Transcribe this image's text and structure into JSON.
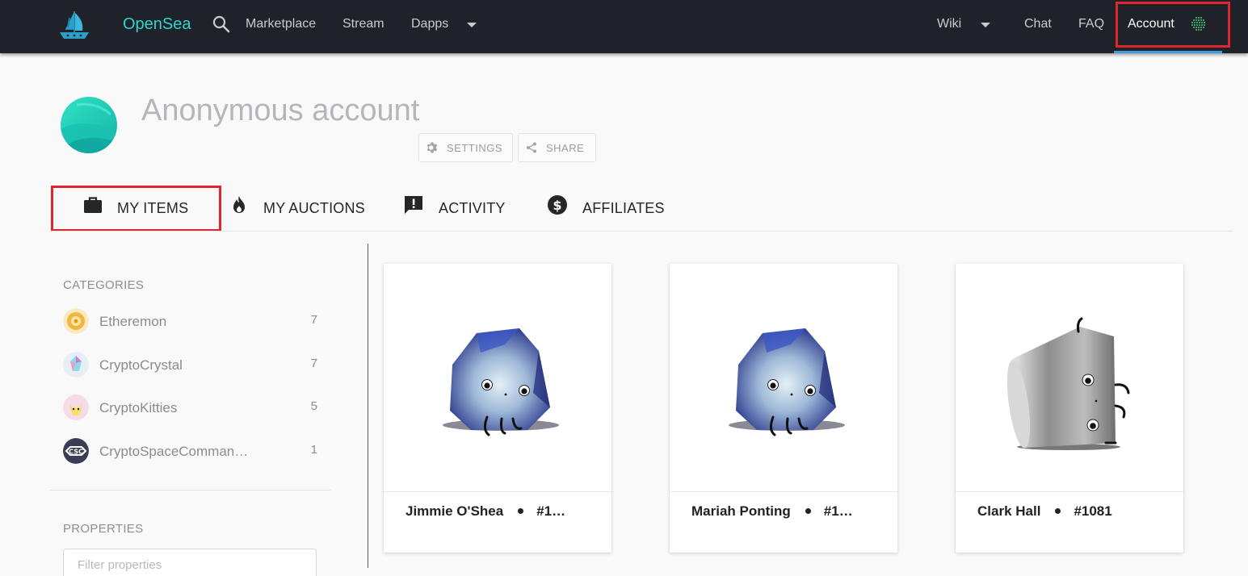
{
  "nav": {
    "brand": "OpenSea",
    "links": [
      "Marketplace",
      "Stream",
      "Dapps"
    ],
    "right_links": [
      "Wiki",
      "Chat",
      "FAQ"
    ],
    "account_label": "Account",
    "icons": {
      "logo": "opensea-ship-logo",
      "search": "search-icon",
      "caret": "caret-down-icon",
      "account": "dotted-globe-icon"
    }
  },
  "profile": {
    "name": "Anonymous account",
    "settings_label": "SETTINGS",
    "share_label": "SHARE"
  },
  "tabs": [
    {
      "label": "MY ITEMS",
      "icon": "briefcase-icon"
    },
    {
      "label": "MY AUCTIONS",
      "icon": "flame-icon"
    },
    {
      "label": "ACTIVITY",
      "icon": "alert-message-icon"
    },
    {
      "label": "AFFILIATES",
      "icon": "dollar-circle-icon"
    }
  ],
  "sidebar": {
    "categories_title": "CATEGORIES",
    "categories": [
      {
        "name": "Etheremon",
        "count": "7"
      },
      {
        "name": "CryptoCrystal",
        "count": "7"
      },
      {
        "name": "CryptoKitties",
        "count": "5"
      },
      {
        "name": "CryptoSpaceComman…",
        "count": "1"
      }
    ],
    "properties_title": "PROPERTIES",
    "filter_placeholder": "Filter properties"
  },
  "items": [
    {
      "name": "Jimmie O'Shea",
      "id": "#1…"
    },
    {
      "name": "Mariah Ponting",
      "id": "#1…"
    },
    {
      "name": "Clark Hall",
      "id": "#1081"
    }
  ],
  "colors": {
    "navbar": "#1f2229",
    "brand": "#2ed6cb",
    "highlight": "#e0252c",
    "active_underline": "#3d9be0"
  }
}
